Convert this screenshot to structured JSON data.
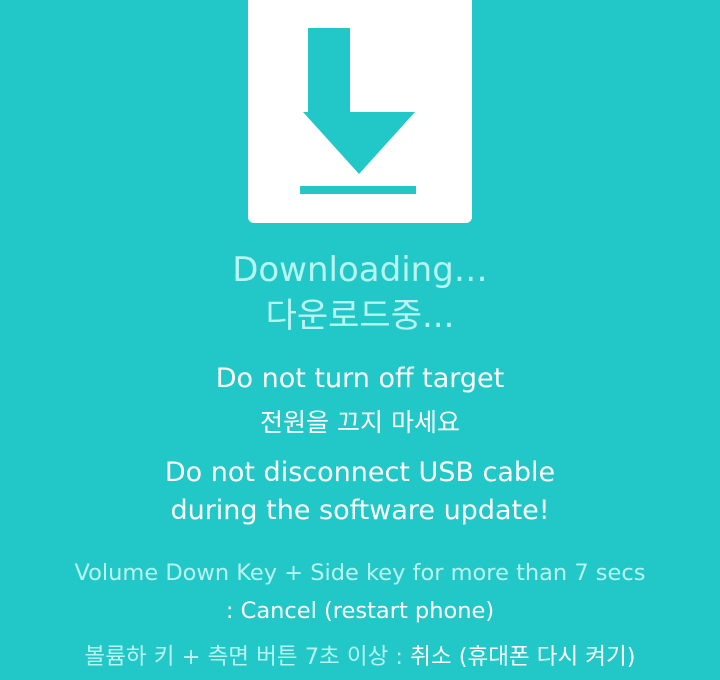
{
  "icon": {
    "name": "download-arrow-icon",
    "background_color": "#ffffff",
    "color": "#22c8c8"
  },
  "colors": {
    "background": "#22c8c8",
    "title_text": "#b8f4f0",
    "body_text": "#ffffff"
  },
  "title": {
    "english": "Downloading…",
    "korean": "다운로드중..."
  },
  "warnings": {
    "power_en": "Do not turn off target",
    "power_ko": "전원을 끄지 마세요",
    "usb_line1": "Do not disconnect USB cable",
    "usb_line2": "during the software update!"
  },
  "cancel_hint": {
    "en_line1": "Volume Down Key + Side key for more than 7 secs",
    "en_line2": ": Cancel (restart phone)",
    "ko_keys": "볼륨하 키 + 측면 버튼 7초 이상 :",
    "ko_action": "취소 (휴대폰 다시 켜기)"
  }
}
